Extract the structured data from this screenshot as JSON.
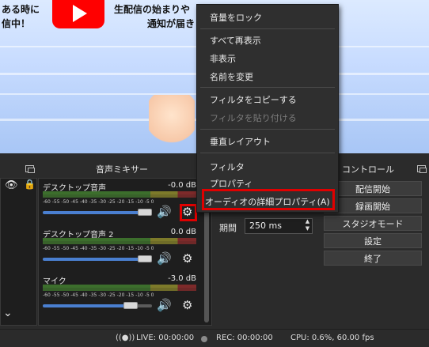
{
  "preview": {
    "text_left_1": "ある時に",
    "text_left_2": "信中！",
    "text_right_1": "生配信の始まりや",
    "text_right_2": "通知が届き"
  },
  "mixer": {
    "title": "音声ミキサー",
    "ticks": "-60 -55 -50 -45 -40 -35 -30 -25 -20 -15 -10  -5  0",
    "tracks": [
      {
        "name": "デスクトップ音声",
        "db": "-0.0 dB",
        "volume_fraction": 0.92
      },
      {
        "name": "デスクトップ音声 2",
        "db": "0.0 dB",
        "volume_fraction": 0.92
      },
      {
        "name": "マイク",
        "db": "-3.0 dB",
        "volume_fraction": 0.78
      }
    ]
  },
  "controls": {
    "title": "コントロール",
    "buttons": [
      "配信開始",
      "録画開始",
      "スタジオモード",
      "設定",
      "終了"
    ]
  },
  "transition": {
    "duration_label": "期間",
    "duration_value": "250 ms"
  },
  "status": {
    "live": "LIVE: 00:00:00",
    "rec": "REC: 00:00:00",
    "cpu": "CPU: 0.6%, 60.00 fps"
  },
  "context_menu": {
    "items": [
      {
        "label": "音量をロック",
        "disabled": false
      },
      {
        "label": "すべて再表示",
        "disabled": false
      },
      {
        "label": "非表示",
        "disabled": false
      },
      {
        "label": "名前を変更",
        "disabled": false
      },
      {
        "label": "フィルタをコピーする",
        "disabled": false
      },
      {
        "label": "フィルタを貼り付ける",
        "disabled": true
      },
      {
        "label": "垂直レイアウト",
        "disabled": false
      },
      {
        "label": "フィルタ",
        "disabled": false
      },
      {
        "label": "プロパティ",
        "disabled": false
      },
      {
        "label": "オーディオの詳細プロパティ(A)",
        "disabled": false
      }
    ]
  },
  "colors": {
    "highlight": "#e00000",
    "slider": "#4a7fd0",
    "background": "#2b2b2b"
  }
}
